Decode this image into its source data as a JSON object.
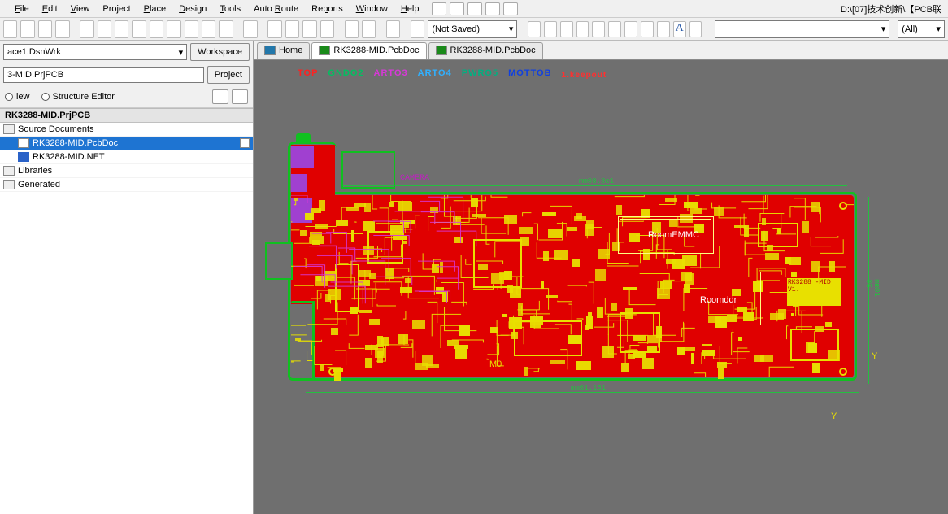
{
  "menu": {
    "items": [
      "File",
      "Edit",
      "View",
      "Project",
      "Place",
      "Design",
      "Tools",
      "Auto Route",
      "Reports",
      "Window",
      "Help"
    ],
    "underline_idx": [
      0,
      0,
      0,
      3,
      0,
      0,
      0,
      5,
      2,
      0,
      0
    ],
    "right_title": "D:\\[07]技术创新\\【PCB联"
  },
  "toolbar": {
    "not_saved": "(Not Saved)",
    "right_empty": "",
    "all_filter": "(All)"
  },
  "left": {
    "workspace": {
      "value": "ace1.DsnWrk",
      "button": "Workspace"
    },
    "project": {
      "value": "3-MID.PrjPCB",
      "button": "Project"
    },
    "view_mode": {
      "left": "iew",
      "right": "Structure Editor"
    }
  },
  "tree": {
    "header": "RK3288-MID.PrjPCB",
    "items": [
      {
        "label": "Source Documents",
        "indent": 0,
        "icon": "minus"
      },
      {
        "label": "RK3288-MID.PcbDoc",
        "indent": 1,
        "icon": "pcb",
        "selected": true,
        "docicon": true
      },
      {
        "label": "RK3288-MID.NET",
        "indent": 1,
        "icon": "net"
      },
      {
        "label": "Libraries",
        "indent": 0,
        "icon": "plus"
      },
      {
        "label": "Generated",
        "indent": 0,
        "icon": "plus"
      }
    ]
  },
  "tabs": [
    {
      "label": "Home",
      "icon": "home",
      "active": false
    },
    {
      "label": "RK3288-MID.PcbDoc",
      "icon": "pcb",
      "active": true
    },
    {
      "label": "RK3288-MID.PcbDoc",
      "icon": "pcb",
      "active": false
    }
  ],
  "canvas": {
    "layers": {
      "top": "TOP",
      "gnd": "GNDO2",
      "art3": "ARTO3",
      "art4": "ARTO4",
      "pwr": "PWRO5",
      "mot": "MOTTOB",
      "keep": "1.keepout"
    },
    "dim_top": "mm08.8c1",
    "dim_bottom": "mm01.161",
    "dim_right_top": "mm01 05",
    "silk_camera": "CAMERA",
    "room1": "RoomEMMC",
    "room2": "Roomddr",
    "corner_text": "RK3288 -MID V1.",
    "marker_m1": "M0",
    "marker_y": "Y"
  }
}
